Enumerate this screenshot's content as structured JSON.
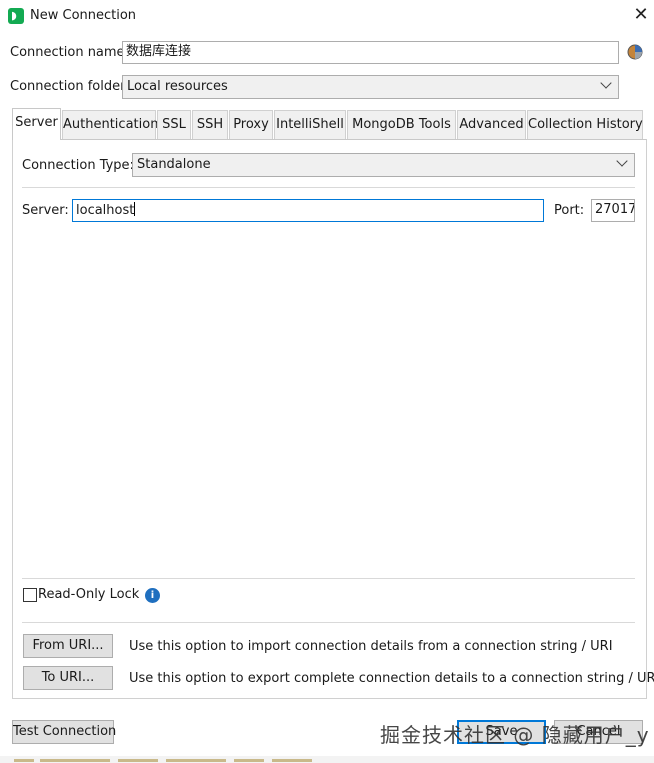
{
  "window": {
    "title": "New Connection",
    "close_glyph": "✕"
  },
  "connection_name": {
    "label": "Connection name:",
    "value": "数据库连接"
  },
  "connection_folder": {
    "label": "Connection folder:",
    "value": "Local resources"
  },
  "tabs": [
    {
      "label": "Server",
      "active": true
    },
    {
      "label": "Authentication"
    },
    {
      "label": "SSL"
    },
    {
      "label": "SSH"
    },
    {
      "label": "Proxy"
    },
    {
      "label": "IntelliShell"
    },
    {
      "label": "MongoDB Tools"
    },
    {
      "label": "Advanced"
    },
    {
      "label": "Collection History"
    }
  ],
  "server_tab": {
    "connection_type_label": "Connection Type:",
    "connection_type_value": "Standalone",
    "server_label": "Server:",
    "server_value": "localhost",
    "port_label": "Port:",
    "port_value": "27017"
  },
  "read_only_lock": {
    "label": "Read-Only Lock",
    "checked": false,
    "info_glyph": "i"
  },
  "uri": {
    "from_button": "From URI...",
    "from_description": "Use this option to import connection details from a connection string / URI",
    "to_button": "To URI...",
    "to_description": "Use this option to export complete connection details to a connection string / URI"
  },
  "footer": {
    "test_button": "Test Connection",
    "save_button": "Save",
    "cancel_button": "Cancel",
    "watermark": "掘金技术社区 @ 隐藏用户_y"
  },
  "colors": {
    "accent_focus": "#0078d7",
    "app_icon": "#13aa52"
  }
}
